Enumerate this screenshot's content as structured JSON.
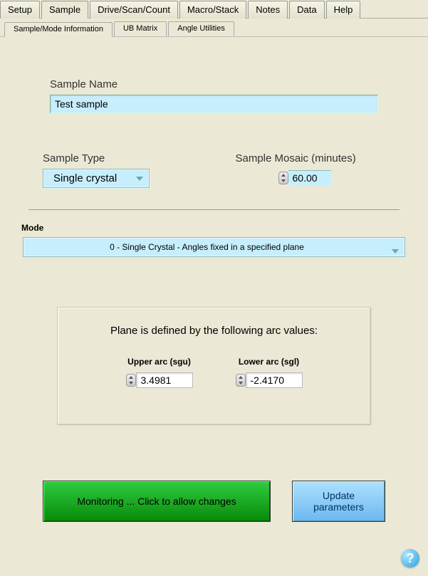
{
  "topTabs": [
    "Setup",
    "Sample",
    "Drive/Scan/Count",
    "Macro/Stack",
    "Notes",
    "Data",
    "Help"
  ],
  "activeTopTab": 1,
  "subTabs": [
    "Sample/Mode Information",
    "UB Matrix",
    "Angle Utilities"
  ],
  "activeSubTab": 0,
  "sampleName": {
    "label": "Sample Name",
    "value": "Test sample"
  },
  "sampleType": {
    "label": "Sample Type",
    "value": "Single crystal"
  },
  "sampleMosaic": {
    "label": "Sample Mosaic (minutes)",
    "value": "60.00"
  },
  "modeLabel": "Mode",
  "modeValue": "0 - Single Crystal - Angles fixed in a specified plane",
  "planeTitle": "Plane is defined by the following arc values:",
  "upperArc": {
    "label": "Upper arc (sgu)",
    "value": "3.4981"
  },
  "lowerArc": {
    "label": "Lower arc (sgl)",
    "value": "-2.4170"
  },
  "monitoringButton": "Monitoring ... Click to allow changes",
  "updateButton": "Update parameters",
  "helpGlyph": "?"
}
